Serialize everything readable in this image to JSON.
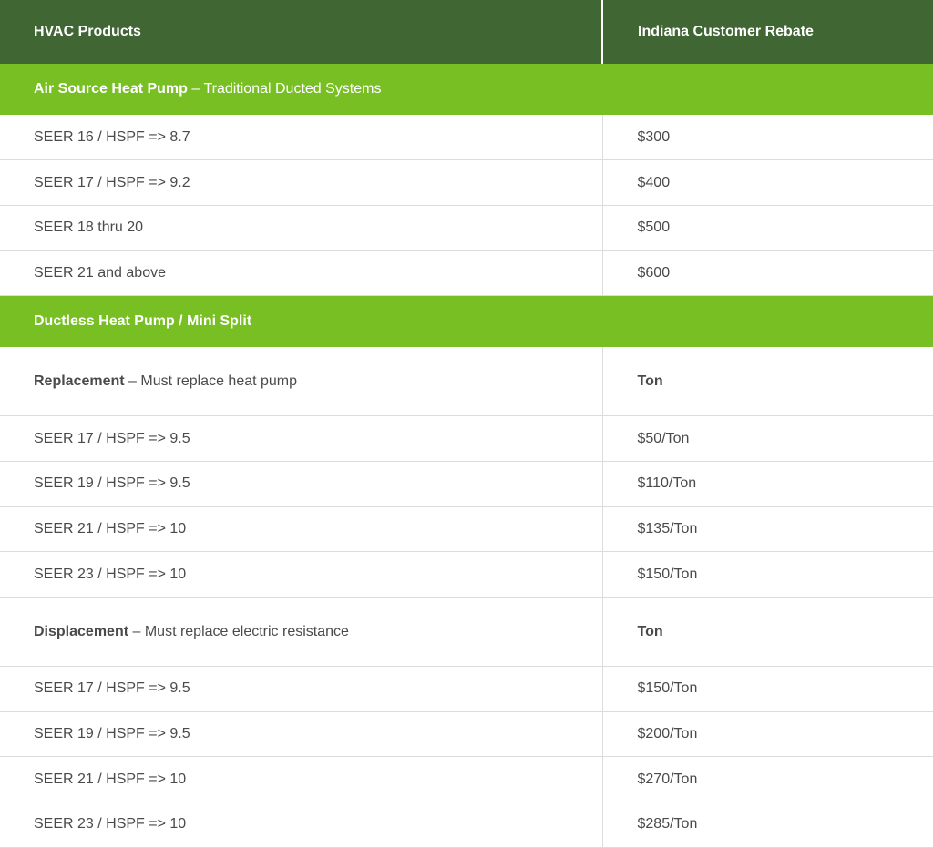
{
  "header": {
    "col1": "HVAC Products",
    "col2": "Indiana Customer Rebate"
  },
  "sections": [
    {
      "title_bold": "Air Source Heat Pump",
      "title_rest": " – Traditional Ducted Systems",
      "rows": [
        {
          "product": "SEER 16 / HSPF => 8.7",
          "rebate": "$300"
        },
        {
          "product": "SEER 17 / HSPF => 9.2",
          "rebate": "$400"
        },
        {
          "product": "SEER 18 thru 20",
          "rebate": "$500"
        },
        {
          "product": "SEER 21 and above",
          "rebate": "$600"
        }
      ]
    },
    {
      "title_bold": "Ductless Heat Pump / Mini Split",
      "subsections": [
        {
          "title_bold": "Replacement",
          "title_rest": " – Must replace heat pump",
          "unit": "Ton",
          "rows": [
            {
              "product": "SEER 17 / HSPF => 9.5",
              "rebate": "$50/Ton"
            },
            {
              "product": "SEER 19 / HSPF => 9.5",
              "rebate": "$110/Ton"
            },
            {
              "product": "SEER 21 / HSPF => 10",
              "rebate": "$135/Ton"
            },
            {
              "product": "SEER 23 / HSPF => 10",
              "rebate": "$150/Ton"
            }
          ]
        },
        {
          "title_bold": "Displacement",
          "title_rest": " – Must replace electric resistance",
          "unit": "Ton",
          "rows": [
            {
              "product": "SEER 17 / HSPF => 9.5",
              "rebate": "$150/Ton"
            },
            {
              "product": "SEER 19 / HSPF => 9.5",
              "rebate": "$200/Ton"
            },
            {
              "product": "SEER 21 / HSPF => 10",
              "rebate": "$270/Ton"
            },
            {
              "product": "SEER 23 / HSPF => 10",
              "rebate": "$285/Ton"
            }
          ]
        }
      ]
    }
  ],
  "colors": {
    "header_bg": "#3f6633",
    "section_bg": "#77bf22",
    "text": "#4a4a4a",
    "divider": "#dcdcdc"
  }
}
